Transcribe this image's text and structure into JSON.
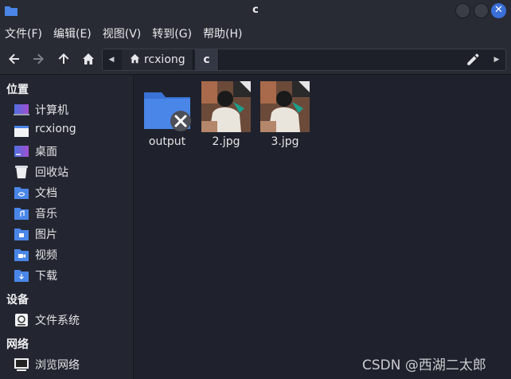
{
  "window": {
    "title": "c"
  },
  "menu": [
    "文件(F)",
    "编辑(E)",
    "视图(V)",
    "转到(G)",
    "帮助(H)"
  ],
  "toolbar": {
    "back_icon": "arrow-left",
    "forward_icon": "arrow-right",
    "up_icon": "arrow-up",
    "home_icon": "home"
  },
  "path": {
    "home_label": "rcxiong",
    "current": "c"
  },
  "sidebar": {
    "places_title": "位置",
    "places": [
      {
        "label": "计算机",
        "icon": "computer-icon"
      },
      {
        "label": "rcxiong",
        "icon": "home-folder-icon"
      },
      {
        "label": "桌面",
        "icon": "desktop-icon"
      },
      {
        "label": "回收站",
        "icon": "trash-icon"
      },
      {
        "label": "文档",
        "icon": "documents-folder-icon"
      },
      {
        "label": "音乐",
        "icon": "music-folder-icon"
      },
      {
        "label": "图片",
        "icon": "pictures-folder-icon"
      },
      {
        "label": "视频",
        "icon": "videos-folder-icon"
      },
      {
        "label": "下载",
        "icon": "downloads-folder-icon"
      }
    ],
    "devices_title": "设备",
    "devices": [
      {
        "label": "文件系统",
        "icon": "drive-icon"
      }
    ],
    "network_title": "网络",
    "network": [
      {
        "label": "浏览网络",
        "icon": "network-icon"
      }
    ]
  },
  "files": [
    {
      "name": "output",
      "kind": "folder",
      "badge": "unreadable"
    },
    {
      "name": "2.jpg",
      "kind": "image"
    },
    {
      "name": "3.jpg",
      "kind": "image"
    }
  ],
  "watermark": "CSDN @西湖二太郎",
  "colors": {
    "accent": "#3b6fd8",
    "folder": "#4a86e8",
    "background": "#1f222c"
  }
}
